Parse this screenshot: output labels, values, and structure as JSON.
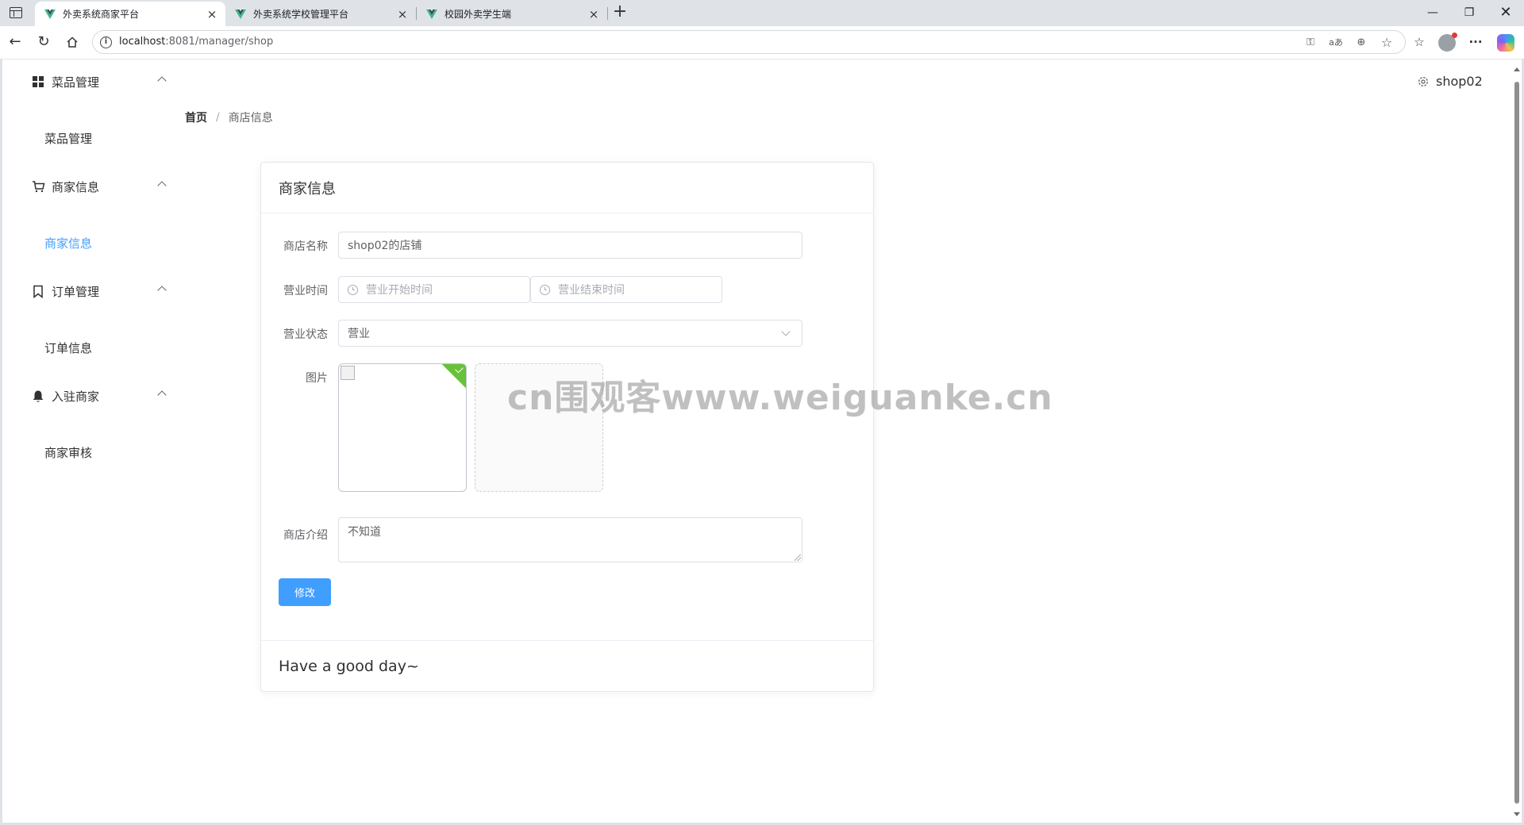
{
  "browser": {
    "tabs": [
      {
        "title": "外卖系统商家平台",
        "active": true
      },
      {
        "title": "外卖系统学校管理平台",
        "active": false
      },
      {
        "title": "校园外卖学生端",
        "active": false
      }
    ],
    "url_host": "localhost",
    "url_path": ":8081/manager/shop"
  },
  "sidebar": {
    "groups": [
      {
        "title": "菜品管理",
        "icon": "grid-icon",
        "item": "菜品管理",
        "active": false
      },
      {
        "title": "商家信息",
        "icon": "cart-icon",
        "item": "商家信息",
        "active": true
      },
      {
        "title": "订单管理",
        "icon": "bookmark-icon",
        "item": "订单信息",
        "active": false
      },
      {
        "title": "入驻商家",
        "icon": "bell-icon",
        "item": "商家审核",
        "active": false
      }
    ]
  },
  "header": {
    "username": "shop02",
    "breadcrumb_home": "首页",
    "breadcrumb_separator": "/",
    "breadcrumb_current": "商店信息"
  },
  "card": {
    "title": "商家信息",
    "footer": "Have a good day~"
  },
  "form": {
    "name_label": "商店名称",
    "name_value": "shop02的店铺",
    "time_label": "营业时间",
    "start_placeholder": "营业开始时间",
    "end_placeholder": "营业结束时间",
    "status_label": "营业状态",
    "status_value": "营业",
    "image_label": "图片",
    "intro_label": "商店介绍",
    "intro_value": "不知道",
    "submit_label": "修改"
  },
  "watermark": "cn围观客www.weiguanke.cn",
  "colors": {
    "primary": "#409eff",
    "success": "#67c23a",
    "text": "#303133"
  }
}
